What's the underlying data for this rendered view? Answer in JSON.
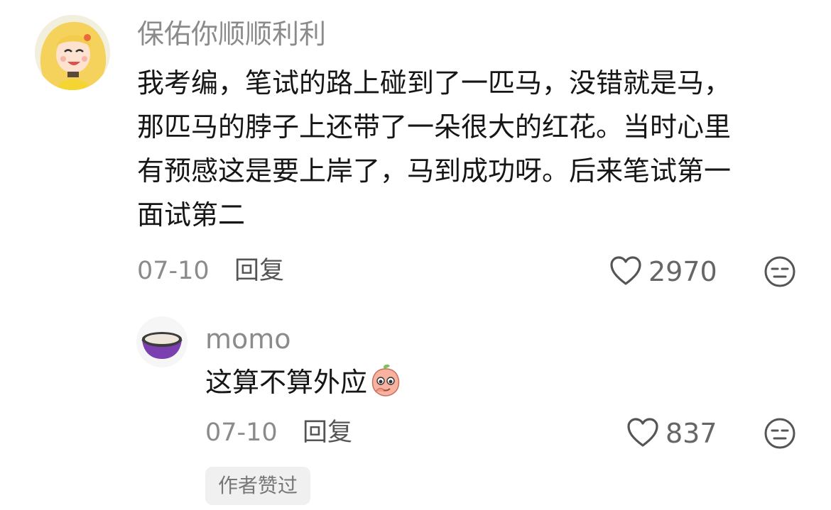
{
  "comment": {
    "username": "保佑你顺顺利利",
    "text_lines": [
      "我考编，笔试的路上碰到了一匹马，没错就是马，",
      "那匹马的脖子上还带了一朵很大的红花。当时心里",
      "有预感这是要上岸了，马到成功呀。后来笔试第一",
      "面试第二"
    ],
    "date": "07-10",
    "reply_label": "回复",
    "like_count": "2970"
  },
  "reply": {
    "username": "momo",
    "text": "这算不算外应",
    "date": "07-10",
    "reply_label": "回复",
    "like_count": "837",
    "author_badge": "作者赞过"
  },
  "icons": {
    "like": "heart-outline-icon",
    "dislike": "meh-face-icon",
    "emoji": "peach-emoji-icon"
  },
  "colors": {
    "username": "#8b8b8b",
    "text": "#161616",
    "badge_bg": "#f0f0f0",
    "bowl_purple": "#7b3fb0"
  }
}
